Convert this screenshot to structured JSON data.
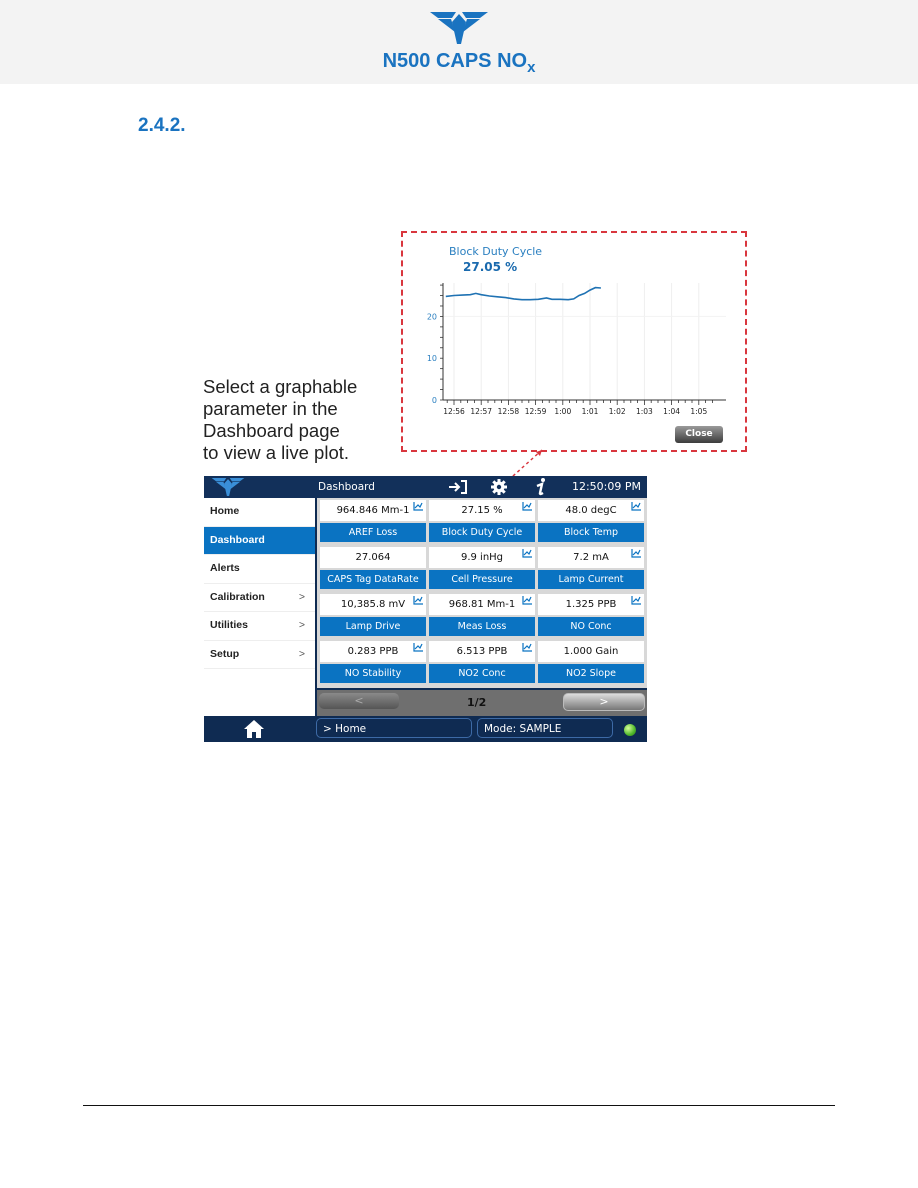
{
  "header": {
    "doc_title": "N500 CAPS NO",
    "doc_title_sub": "x",
    "brand_color": "#1a73c0"
  },
  "section": {
    "number": "2.4.2."
  },
  "caption": {
    "lines": [
      "Select a graphable",
      "parameter in the",
      "Dashboard page",
      "to view a live plot."
    ]
  },
  "plot_popup": {
    "title": "Block Duty Cycle",
    "value": "27.05 %",
    "close_label": "Close",
    "chart_data": {
      "type": "line",
      "title": "Block Duty Cycle",
      "xlabel": "",
      "ylabel": "",
      "ylim": [
        0,
        28
      ],
      "y_ticks": [
        0,
        10,
        20
      ],
      "x_ticks": [
        "12:56",
        "12:57",
        "12:58",
        "12:59",
        "1:00",
        "1:01",
        "1:02",
        "1:03",
        "1:04",
        "1:05"
      ],
      "grid": true,
      "series": [
        {
          "name": "Block Duty Cycle",
          "x_minutes_from_1256": [
            -0.3,
            0.0,
            0.3,
            0.6,
            0.8,
            1.0,
            1.3,
            1.6,
            1.9,
            2.2,
            2.5,
            2.8,
            3.1,
            3.4,
            3.6,
            3.9,
            4.2,
            4.4,
            4.6,
            4.8,
            5.0,
            5.2,
            5.4
          ],
          "values": [
            24.8,
            25.0,
            25.1,
            25.2,
            25.5,
            25.2,
            24.9,
            24.7,
            24.5,
            24.2,
            24.0,
            24.0,
            24.1,
            24.4,
            24.1,
            24.1,
            24.0,
            24.2,
            25.0,
            25.5,
            26.3,
            26.9,
            26.8
          ]
        }
      ]
    }
  },
  "screen": {
    "topbar": {
      "title": "Dashboard",
      "clock": "12:50:09 PM",
      "icons": [
        "login-icon",
        "gear-icon",
        "info-icon"
      ]
    },
    "sidebar": {
      "items": [
        {
          "label": "Home",
          "chevron": false,
          "active": false
        },
        {
          "label": "Dashboard",
          "chevron": false,
          "active": true
        },
        {
          "label": "Alerts",
          "chevron": false,
          "active": false
        },
        {
          "label": "Calibration",
          "chevron": true,
          "active": false
        },
        {
          "label": "Utilities",
          "chevron": true,
          "active": false
        },
        {
          "label": "Setup",
          "chevron": true,
          "active": false
        }
      ],
      "chevron_glyph": ">"
    },
    "tiles": [
      {
        "value": "964.846 Mm-1",
        "label": "AREF Loss",
        "graphable": true
      },
      {
        "value": "27.15 %",
        "label": "Block Duty Cycle",
        "graphable": true
      },
      {
        "value": "48.0 degC",
        "label": "Block Temp",
        "graphable": true
      },
      {
        "value": "27.064",
        "label": "CAPS Tag DataRate",
        "graphable": false
      },
      {
        "value": "9.9 inHg",
        "label": "Cell Pressure",
        "graphable": true
      },
      {
        "value": "7.2 mA",
        "label": "Lamp Current",
        "graphable": true
      },
      {
        "value": "10,385.8 mV",
        "label": "Lamp Drive",
        "graphable": true
      },
      {
        "value": "968.81 Mm-1",
        "label": "Meas Loss",
        "graphable": true
      },
      {
        "value": "1.325 PPB",
        "label": "NO Conc",
        "graphable": true
      },
      {
        "value": "0.283 PPB",
        "label": "NO Stability",
        "graphable": true
      },
      {
        "value": "6.513 PPB",
        "label": "NO2 Conc",
        "graphable": true
      },
      {
        "value": "1.000 Gain",
        "label": "NO2 Slope",
        "graphable": false
      }
    ],
    "pager": {
      "prev": "<",
      "page": "1/2",
      "next": ">"
    },
    "bottombar": {
      "breadcrumb": "> Home",
      "mode": "Mode: SAMPLE",
      "status_color": "#4fb82a"
    }
  }
}
